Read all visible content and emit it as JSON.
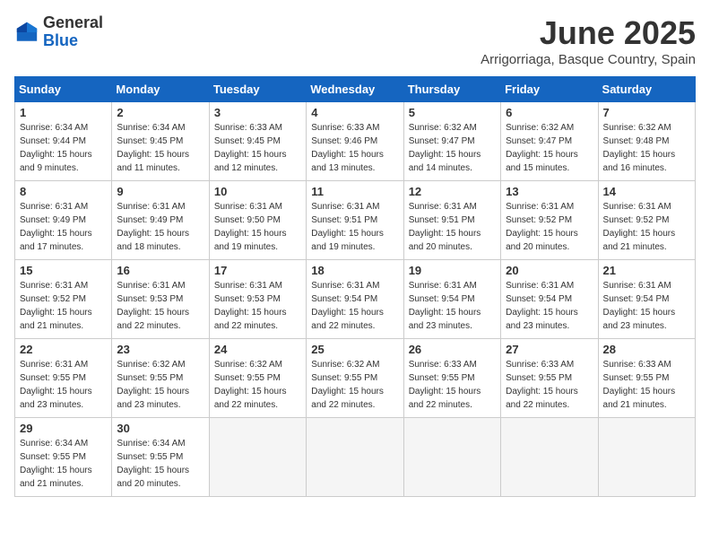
{
  "header": {
    "logo_general": "General",
    "logo_blue": "Blue",
    "month_title": "June 2025",
    "location": "Arrigorriaga, Basque Country, Spain"
  },
  "calendar": {
    "weekdays": [
      "Sunday",
      "Monday",
      "Tuesday",
      "Wednesday",
      "Thursday",
      "Friday",
      "Saturday"
    ],
    "weeks": [
      [
        null,
        null,
        {
          "day": "3",
          "sunrise": "Sunrise: 6:33 AM",
          "sunset": "Sunset: 9:45 PM",
          "daylight": "Daylight: 15 hours and 12 minutes."
        },
        {
          "day": "4",
          "sunrise": "Sunrise: 6:33 AM",
          "sunset": "Sunset: 9:46 PM",
          "daylight": "Daylight: 15 hours and 13 minutes."
        },
        {
          "day": "5",
          "sunrise": "Sunrise: 6:32 AM",
          "sunset": "Sunset: 9:47 PM",
          "daylight": "Daylight: 15 hours and 14 minutes."
        },
        {
          "day": "6",
          "sunrise": "Sunrise: 6:32 AM",
          "sunset": "Sunset: 9:47 PM",
          "daylight": "Daylight: 15 hours and 15 minutes."
        },
        {
          "day": "7",
          "sunrise": "Sunrise: 6:32 AM",
          "sunset": "Sunset: 9:48 PM",
          "daylight": "Daylight: 15 hours and 16 minutes."
        }
      ],
      [
        {
          "day": "1",
          "sunrise": "Sunrise: 6:34 AM",
          "sunset": "Sunset: 9:44 PM",
          "daylight": "Daylight: 15 hours and 9 minutes."
        },
        {
          "day": "2",
          "sunrise": "Sunrise: 6:34 AM",
          "sunset": "Sunset: 9:45 PM",
          "daylight": "Daylight: 15 hours and 11 minutes."
        },
        {
          "day": "3",
          "sunrise": "Sunrise: 6:33 AM",
          "sunset": "Sunset: 9:45 PM",
          "daylight": "Daylight: 15 hours and 12 minutes."
        },
        {
          "day": "4",
          "sunrise": "Sunrise: 6:33 AM",
          "sunset": "Sunset: 9:46 PM",
          "daylight": "Daylight: 15 hours and 13 minutes."
        },
        {
          "day": "5",
          "sunrise": "Sunrise: 6:32 AM",
          "sunset": "Sunset: 9:47 PM",
          "daylight": "Daylight: 15 hours and 14 minutes."
        },
        {
          "day": "6",
          "sunrise": "Sunrise: 6:32 AM",
          "sunset": "Sunset: 9:47 PM",
          "daylight": "Daylight: 15 hours and 15 minutes."
        },
        {
          "day": "7",
          "sunrise": "Sunrise: 6:32 AM",
          "sunset": "Sunset: 9:48 PM",
          "daylight": "Daylight: 15 hours and 16 minutes."
        }
      ],
      [
        {
          "day": "8",
          "sunrise": "Sunrise: 6:31 AM",
          "sunset": "Sunset: 9:49 PM",
          "daylight": "Daylight: 15 hours and 17 minutes."
        },
        {
          "day": "9",
          "sunrise": "Sunrise: 6:31 AM",
          "sunset": "Sunset: 9:49 PM",
          "daylight": "Daylight: 15 hours and 18 minutes."
        },
        {
          "day": "10",
          "sunrise": "Sunrise: 6:31 AM",
          "sunset": "Sunset: 9:50 PM",
          "daylight": "Daylight: 15 hours and 19 minutes."
        },
        {
          "day": "11",
          "sunrise": "Sunrise: 6:31 AM",
          "sunset": "Sunset: 9:51 PM",
          "daylight": "Daylight: 15 hours and 19 minutes."
        },
        {
          "day": "12",
          "sunrise": "Sunrise: 6:31 AM",
          "sunset": "Sunset: 9:51 PM",
          "daylight": "Daylight: 15 hours and 20 minutes."
        },
        {
          "day": "13",
          "sunrise": "Sunrise: 6:31 AM",
          "sunset": "Sunset: 9:52 PM",
          "daylight": "Daylight: 15 hours and 20 minutes."
        },
        {
          "day": "14",
          "sunrise": "Sunrise: 6:31 AM",
          "sunset": "Sunset: 9:52 PM",
          "daylight": "Daylight: 15 hours and 21 minutes."
        }
      ],
      [
        {
          "day": "15",
          "sunrise": "Sunrise: 6:31 AM",
          "sunset": "Sunset: 9:52 PM",
          "daylight": "Daylight: 15 hours and 21 minutes."
        },
        {
          "day": "16",
          "sunrise": "Sunrise: 6:31 AM",
          "sunset": "Sunset: 9:53 PM",
          "daylight": "Daylight: 15 hours and 22 minutes."
        },
        {
          "day": "17",
          "sunrise": "Sunrise: 6:31 AM",
          "sunset": "Sunset: 9:53 PM",
          "daylight": "Daylight: 15 hours and 22 minutes."
        },
        {
          "day": "18",
          "sunrise": "Sunrise: 6:31 AM",
          "sunset": "Sunset: 9:54 PM",
          "daylight": "Daylight: 15 hours and 22 minutes."
        },
        {
          "day": "19",
          "sunrise": "Sunrise: 6:31 AM",
          "sunset": "Sunset: 9:54 PM",
          "daylight": "Daylight: 15 hours and 23 minutes."
        },
        {
          "day": "20",
          "sunrise": "Sunrise: 6:31 AM",
          "sunset": "Sunset: 9:54 PM",
          "daylight": "Daylight: 15 hours and 23 minutes."
        },
        {
          "day": "21",
          "sunrise": "Sunrise: 6:31 AM",
          "sunset": "Sunset: 9:54 PM",
          "daylight": "Daylight: 15 hours and 23 minutes."
        }
      ],
      [
        {
          "day": "22",
          "sunrise": "Sunrise: 6:31 AM",
          "sunset": "Sunset: 9:55 PM",
          "daylight": "Daylight: 15 hours and 23 minutes."
        },
        {
          "day": "23",
          "sunrise": "Sunrise: 6:32 AM",
          "sunset": "Sunset: 9:55 PM",
          "daylight": "Daylight: 15 hours and 23 minutes."
        },
        {
          "day": "24",
          "sunrise": "Sunrise: 6:32 AM",
          "sunset": "Sunset: 9:55 PM",
          "daylight": "Daylight: 15 hours and 22 minutes."
        },
        {
          "day": "25",
          "sunrise": "Sunrise: 6:32 AM",
          "sunset": "Sunset: 9:55 PM",
          "daylight": "Daylight: 15 hours and 22 minutes."
        },
        {
          "day": "26",
          "sunrise": "Sunrise: 6:33 AM",
          "sunset": "Sunset: 9:55 PM",
          "daylight": "Daylight: 15 hours and 22 minutes."
        },
        {
          "day": "27",
          "sunrise": "Sunrise: 6:33 AM",
          "sunset": "Sunset: 9:55 PM",
          "daylight": "Daylight: 15 hours and 22 minutes."
        },
        {
          "day": "28",
          "sunrise": "Sunrise: 6:33 AM",
          "sunset": "Sunset: 9:55 PM",
          "daylight": "Daylight: 15 hours and 21 minutes."
        }
      ],
      [
        {
          "day": "29",
          "sunrise": "Sunrise: 6:34 AM",
          "sunset": "Sunset: 9:55 PM",
          "daylight": "Daylight: 15 hours and 21 minutes."
        },
        {
          "day": "30",
          "sunrise": "Sunrise: 6:34 AM",
          "sunset": "Sunset: 9:55 PM",
          "daylight": "Daylight: 15 hours and 20 minutes."
        },
        null,
        null,
        null,
        null,
        null
      ]
    ]
  }
}
